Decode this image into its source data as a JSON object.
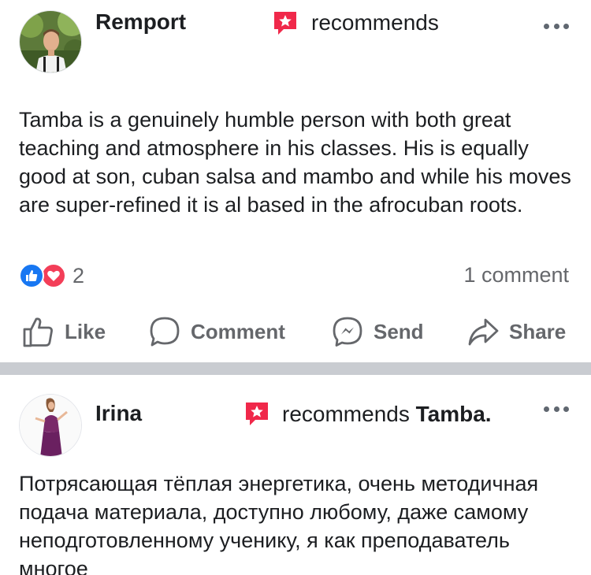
{
  "post1": {
    "author": "Remport",
    "action": "recommends",
    "body": "Tamba is a genuinely humble person with both great teaching and atmosphere in his classes. His is equally good at son, cuban salsa and mambo and while his moves are super-refined it is al based in the afrocuban roots.",
    "reaction_count": "2",
    "comment_count": "1 comment",
    "actions": {
      "like": "Like",
      "comment": "Comment",
      "send": "Send",
      "share": "Share"
    }
  },
  "post2": {
    "author": "Irina",
    "action": "recommends",
    "target": "Tamba.",
    "body": "Потрясающая тёплая энергетика, очень методичная подача материала, доступно любому, даже самому неподготовленному ученику, я как преподаватель многое"
  },
  "colors": {
    "recommend_icon": "#f0284a",
    "like_reaction": "#1877f2",
    "love_reaction": "#f33e58",
    "secondary_text": "#65676b",
    "separator": "#c9ccd1"
  }
}
